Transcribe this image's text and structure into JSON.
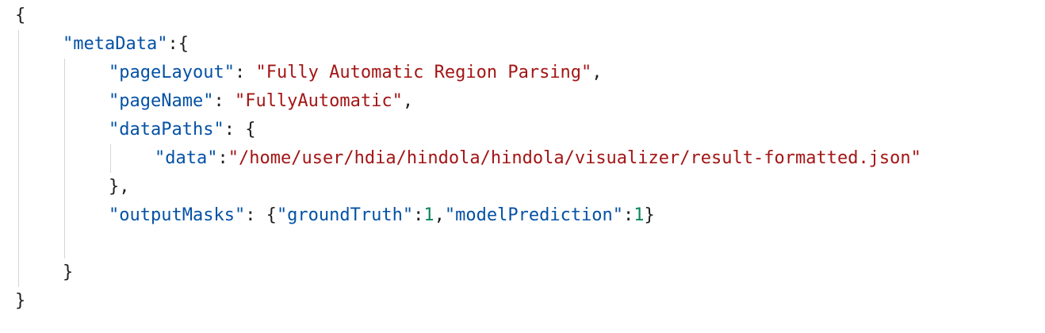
{
  "editor": {
    "colors": {
      "background": "#ffffff",
      "key": "#0451a5",
      "string": "#a31515",
      "number": "#098658",
      "punctuation": "#1f1f1f",
      "indent_guide": "#d4d4d4"
    },
    "root_open": "{",
    "metadata_key": "\"metaData\"",
    "metadata_sep": ":{",
    "page_layout_key": "\"pageLayout\"",
    "page_layout_sep": ": ",
    "page_layout_value": "\"Fully Automatic Region Parsing\"",
    "page_layout_comma": ",",
    "page_name_key": "\"pageName\"",
    "page_name_sep": ": ",
    "page_name_value": "\"FullyAutomatic\"",
    "page_name_comma": ",",
    "data_paths_key": "\"dataPaths\"",
    "data_paths_sep": ": {",
    "data_key": "\"data\"",
    "data_sep": ":",
    "data_value": "\"/home/user/hdia/hindola/hindola/visualizer/result-formatted.json\"",
    "data_paths_close": "},",
    "output_masks_key": "\"outputMasks\"",
    "output_masks_sep": ": {",
    "ground_truth_key": "\"groundTruth\"",
    "ground_truth_sep": ":",
    "ground_truth_value": "1",
    "masks_comma": ",",
    "model_prediction_key": "\"modelPrediction\"",
    "model_prediction_sep": ":",
    "model_prediction_value": "1",
    "output_masks_close": "}",
    "metadata_close": "}",
    "root_close": "}"
  }
}
